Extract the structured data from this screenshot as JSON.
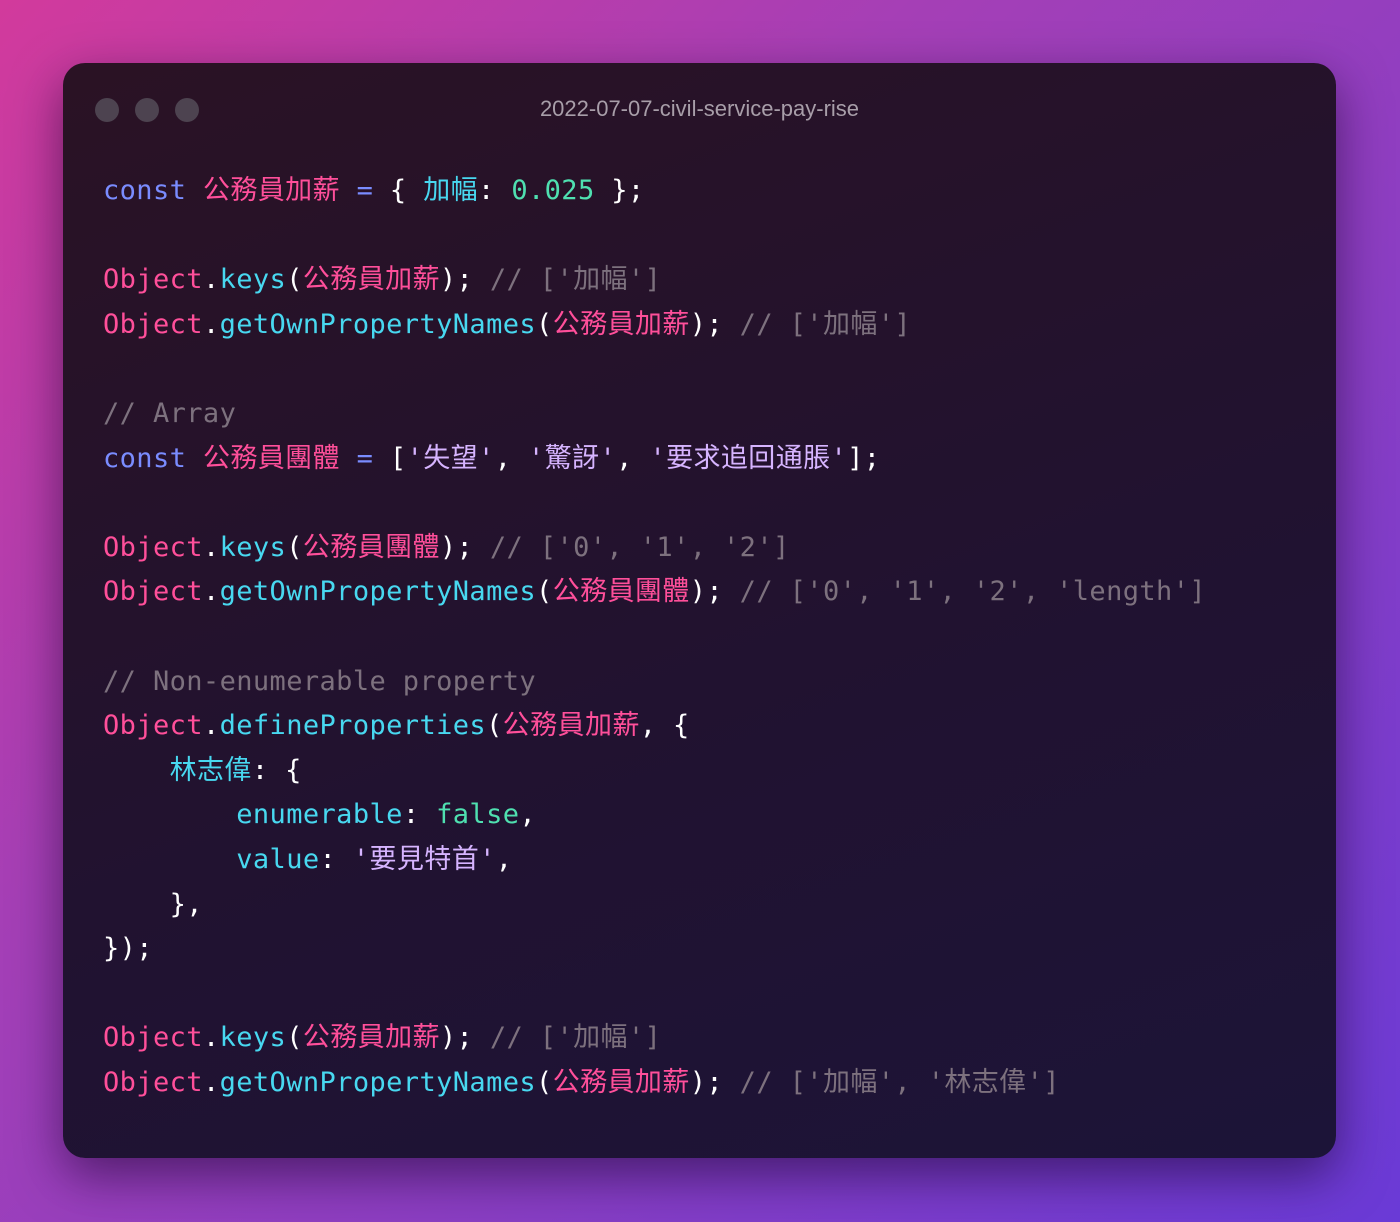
{
  "window": {
    "title": "2022-07-07-civil-service-pay-rise",
    "controls": [
      "close",
      "minimize",
      "maximize"
    ]
  },
  "colors": {
    "keyword": "#7a8cff",
    "variable": "#ff4f9a",
    "method": "#48d8f0",
    "number": "#4fe0b0",
    "string": "#d6b4ff",
    "comment": "#7d717e",
    "punct": "#ffffff"
  },
  "code_lines": [
    [
      {
        "t": "const",
        "k": "keyword"
      },
      {
        "t": " ",
        "k": "punct"
      },
      {
        "t": "公務員加薪",
        "k": "variable"
      },
      {
        "t": " ",
        "k": "punct"
      },
      {
        "t": "=",
        "k": "operator"
      },
      {
        "t": " { ",
        "k": "punct"
      },
      {
        "t": "加幅",
        "k": "property"
      },
      {
        "t": ": ",
        "k": "punct"
      },
      {
        "t": "0.025",
        "k": "number"
      },
      {
        "t": " };",
        "k": "punct"
      }
    ],
    [],
    [
      {
        "t": "Object",
        "k": "object"
      },
      {
        "t": ".",
        "k": "punct"
      },
      {
        "t": "keys",
        "k": "method"
      },
      {
        "t": "(",
        "k": "punct"
      },
      {
        "t": "公務員加薪",
        "k": "variable"
      },
      {
        "t": "); ",
        "k": "punct"
      },
      {
        "t": "// ['加幅']",
        "k": "comment"
      }
    ],
    [
      {
        "t": "Object",
        "k": "object"
      },
      {
        "t": ".",
        "k": "punct"
      },
      {
        "t": "getOwnPropertyNames",
        "k": "method"
      },
      {
        "t": "(",
        "k": "punct"
      },
      {
        "t": "公務員加薪",
        "k": "variable"
      },
      {
        "t": "); ",
        "k": "punct"
      },
      {
        "t": "// ['加幅']",
        "k": "comment"
      }
    ],
    [],
    [
      {
        "t": "// Array",
        "k": "comment"
      }
    ],
    [
      {
        "t": "const",
        "k": "keyword"
      },
      {
        "t": " ",
        "k": "punct"
      },
      {
        "t": "公務員團體",
        "k": "variable"
      },
      {
        "t": " ",
        "k": "punct"
      },
      {
        "t": "=",
        "k": "operator"
      },
      {
        "t": " [",
        "k": "punct"
      },
      {
        "t": "'失望'",
        "k": "string"
      },
      {
        "t": ", ",
        "k": "punct"
      },
      {
        "t": "'驚訝'",
        "k": "string"
      },
      {
        "t": ", ",
        "k": "punct"
      },
      {
        "t": "'要求追回通脹'",
        "k": "string"
      },
      {
        "t": "];",
        "k": "punct"
      }
    ],
    [],
    [
      {
        "t": "Object",
        "k": "object"
      },
      {
        "t": ".",
        "k": "punct"
      },
      {
        "t": "keys",
        "k": "method"
      },
      {
        "t": "(",
        "k": "punct"
      },
      {
        "t": "公務員團體",
        "k": "variable"
      },
      {
        "t": "); ",
        "k": "punct"
      },
      {
        "t": "// ['0', '1', '2']",
        "k": "comment"
      }
    ],
    [
      {
        "t": "Object",
        "k": "object"
      },
      {
        "t": ".",
        "k": "punct"
      },
      {
        "t": "getOwnPropertyNames",
        "k": "method"
      },
      {
        "t": "(",
        "k": "punct"
      },
      {
        "t": "公務員團體",
        "k": "variable"
      },
      {
        "t": "); ",
        "k": "punct"
      },
      {
        "t": "// ['0', '1', '2', 'length']",
        "k": "comment"
      }
    ],
    [],
    [
      {
        "t": "// Non-enumerable property",
        "k": "comment"
      }
    ],
    [
      {
        "t": "Object",
        "k": "object"
      },
      {
        "t": ".",
        "k": "punct"
      },
      {
        "t": "defineProperties",
        "k": "method"
      },
      {
        "t": "(",
        "k": "punct"
      },
      {
        "t": "公務員加薪",
        "k": "variable"
      },
      {
        "t": ", {",
        "k": "punct"
      }
    ],
    [
      {
        "t": "    ",
        "k": "punct"
      },
      {
        "t": "林志偉",
        "k": "property"
      },
      {
        "t": ": {",
        "k": "punct"
      }
    ],
    [
      {
        "t": "        ",
        "k": "punct"
      },
      {
        "t": "enumerable",
        "k": "property"
      },
      {
        "t": ": ",
        "k": "punct"
      },
      {
        "t": "false",
        "k": "boolean"
      },
      {
        "t": ",",
        "k": "punct"
      }
    ],
    [
      {
        "t": "        ",
        "k": "punct"
      },
      {
        "t": "value",
        "k": "property"
      },
      {
        "t": ": ",
        "k": "punct"
      },
      {
        "t": "'要見特首'",
        "k": "string"
      },
      {
        "t": ",",
        "k": "punct"
      }
    ],
    [
      {
        "t": "    },",
        "k": "punct"
      }
    ],
    [
      {
        "t": "});",
        "k": "punct"
      }
    ],
    [],
    [
      {
        "t": "Object",
        "k": "object"
      },
      {
        "t": ".",
        "k": "punct"
      },
      {
        "t": "keys",
        "k": "method"
      },
      {
        "t": "(",
        "k": "punct"
      },
      {
        "t": "公務員加薪",
        "k": "variable"
      },
      {
        "t": "); ",
        "k": "punct"
      },
      {
        "t": "// ['加幅']",
        "k": "comment"
      }
    ],
    [
      {
        "t": "Object",
        "k": "object"
      },
      {
        "t": ".",
        "k": "punct"
      },
      {
        "t": "getOwnPropertyNames",
        "k": "method"
      },
      {
        "t": "(",
        "k": "punct"
      },
      {
        "t": "公務員加薪",
        "k": "variable"
      },
      {
        "t": "); ",
        "k": "punct"
      },
      {
        "t": "// ['加幅', '林志偉']",
        "k": "comment"
      }
    ]
  ]
}
